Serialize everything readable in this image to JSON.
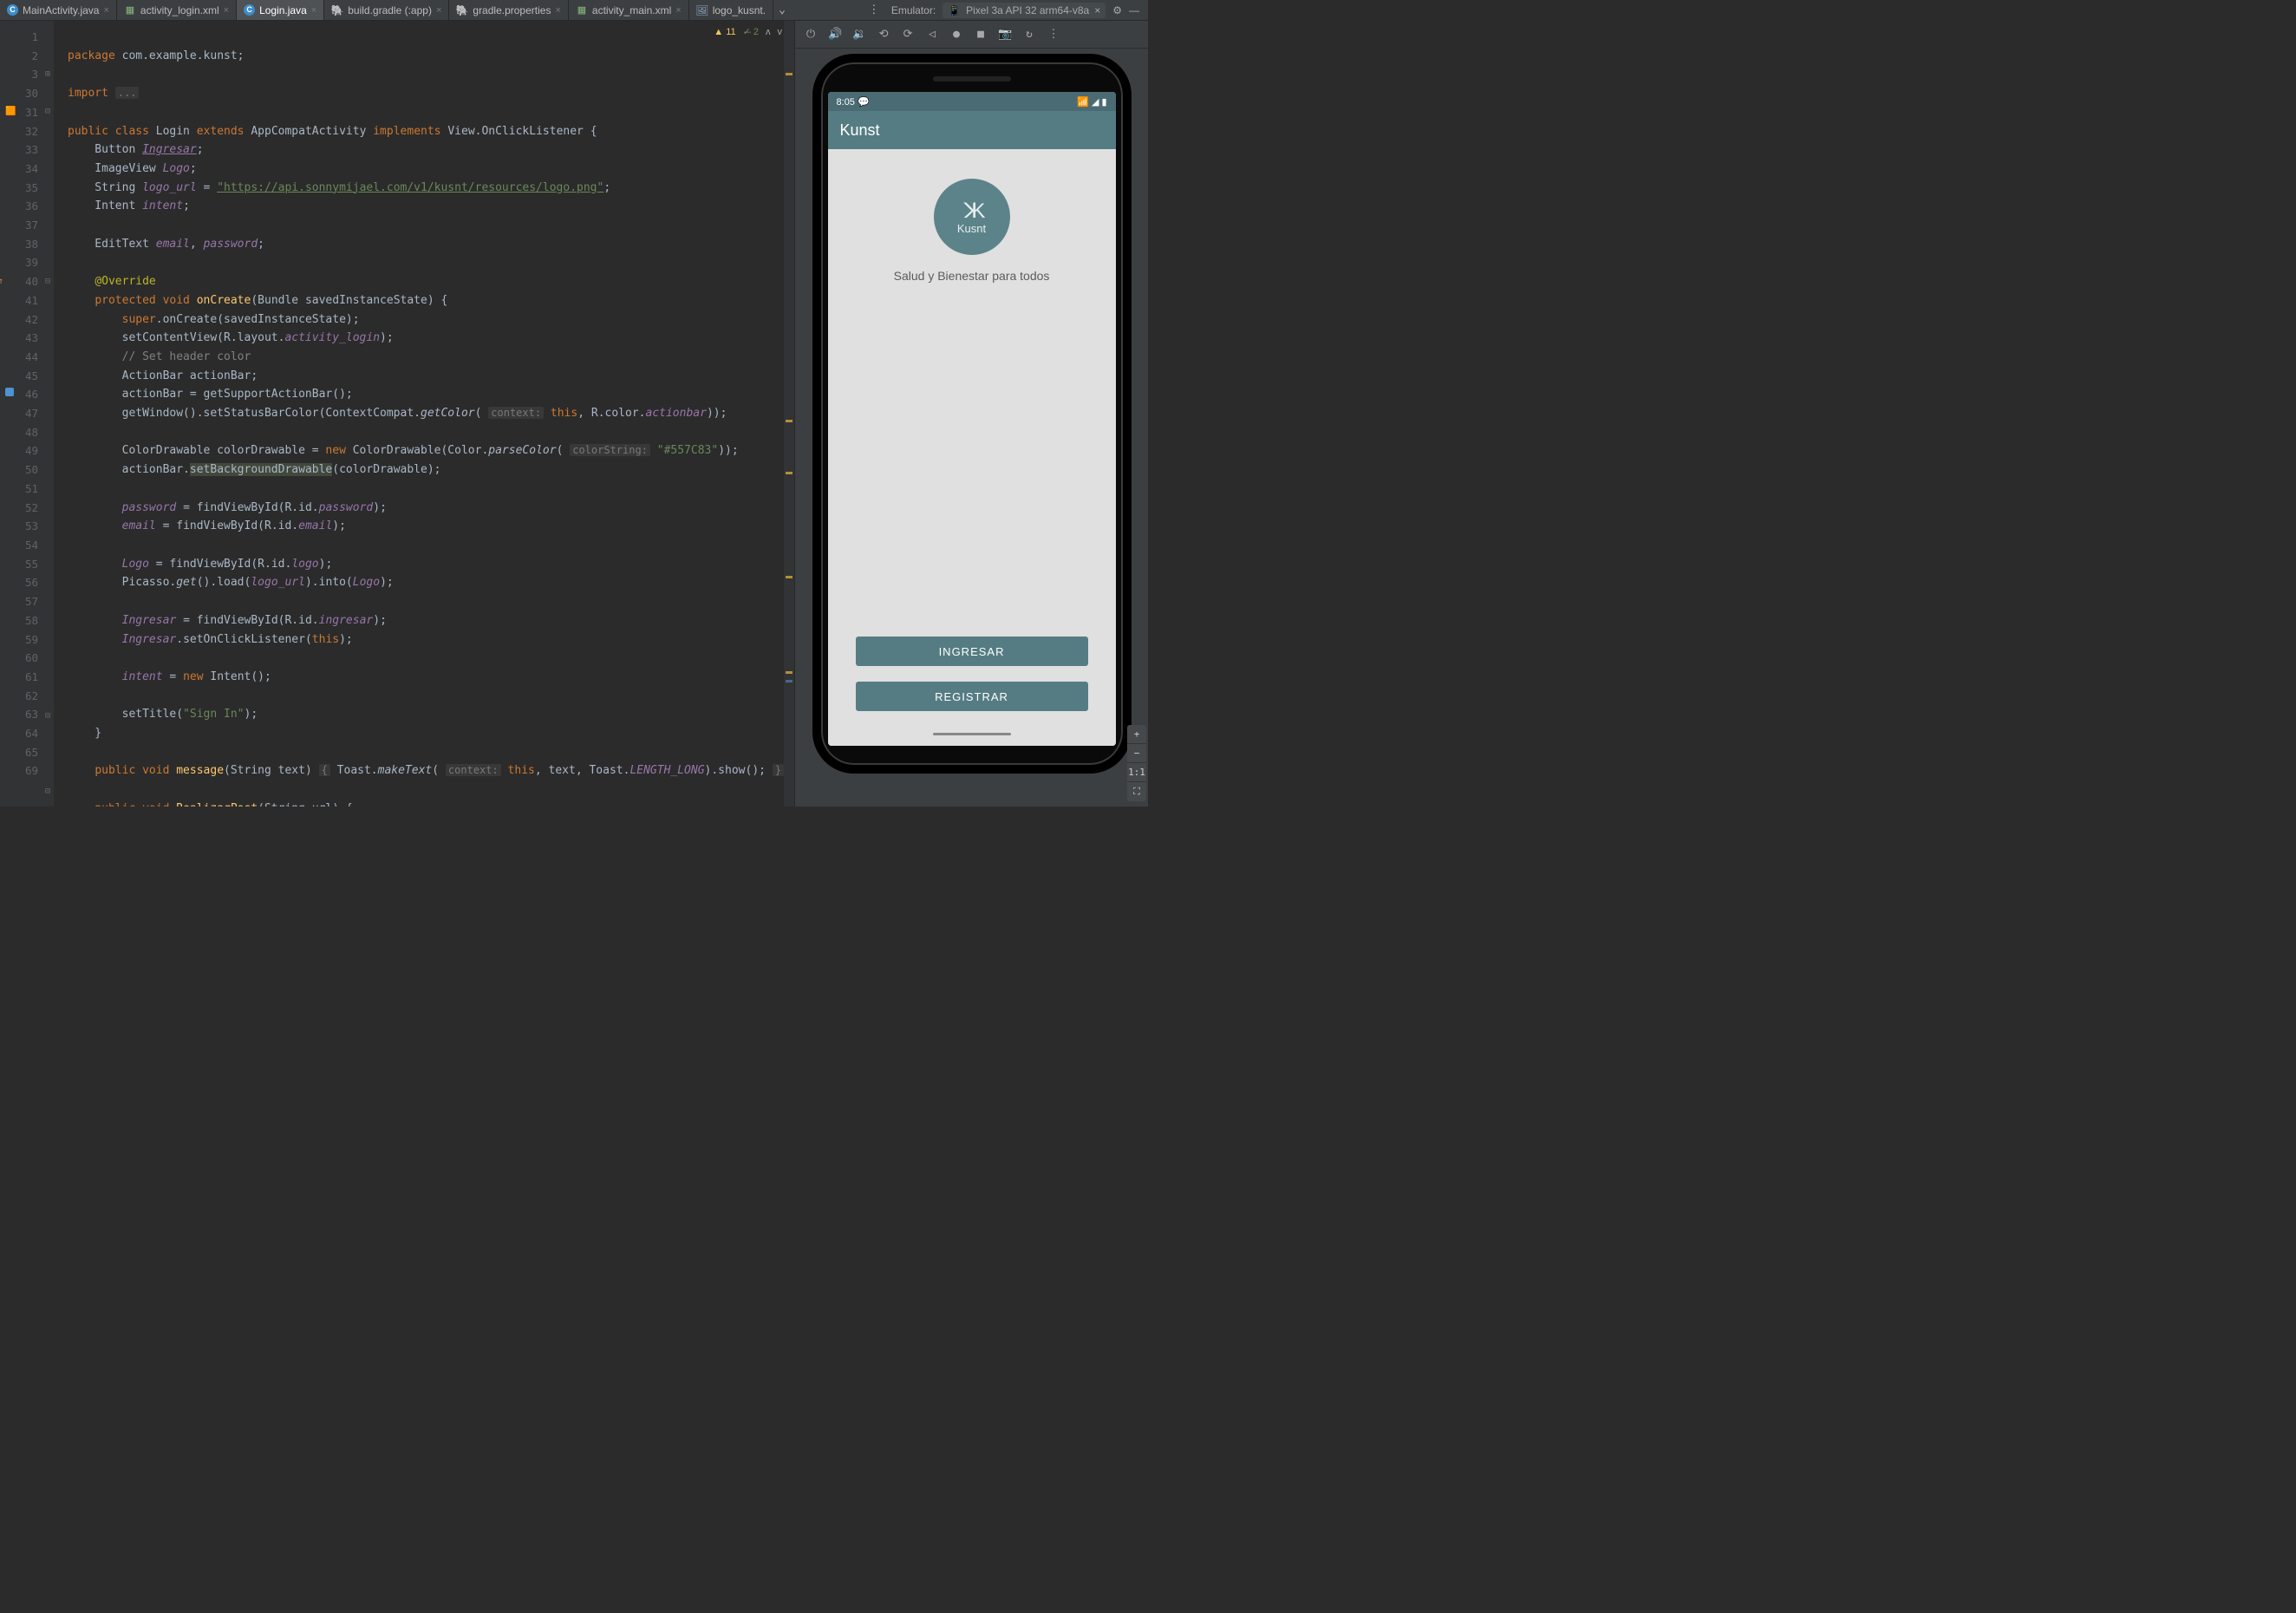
{
  "tabs": [
    {
      "label": "MainActivity.java",
      "type": "class"
    },
    {
      "label": "activity_login.xml",
      "type": "xml"
    },
    {
      "label": "Login.java",
      "type": "class",
      "active": true
    },
    {
      "label": "build.gradle (:app)",
      "type": "gradle"
    },
    {
      "label": "gradle.properties",
      "type": "props"
    },
    {
      "label": "activity_main.xml",
      "type": "xml"
    },
    {
      "label": "logo_kusnt.",
      "type": "img"
    }
  ],
  "emulator_header": {
    "label": "Emulator:",
    "device": "Pixel 3a API 32 arm64-v8a"
  },
  "editor_badges": {
    "warn_count": "11",
    "ok_count": "2"
  },
  "gutter_lines": [
    "1",
    "2",
    "3",
    "30",
    "31",
    "32",
    "33",
    "34",
    "35",
    "36",
    "37",
    "38",
    "39",
    "40",
    "41",
    "42",
    "43",
    "44",
    "45",
    "46",
    "47",
    "48",
    "49",
    "50",
    "51",
    "52",
    "53",
    "54",
    "55",
    "56",
    "57",
    "58",
    "59",
    "60",
    "61",
    "62",
    "63",
    "64",
    "65",
    "",
    "69"
  ],
  "code": {
    "l1_package": "package",
    "l1_pkg": " com.example.kunst;",
    "l3_import": "import",
    "l3_dots": "...",
    "l31_public": "public class",
    "l31_name": " Login ",
    "l31_extends": "extends",
    "l31_super": " AppCompatActivity ",
    "l31_implements": "implements",
    "l31_iface": " View.OnClickListener {",
    "l32": "    Button ",
    "l32_f": "Ingresar",
    "l33": "    ImageView ",
    "l33_f": "Logo",
    "l34": "    String ",
    "l34_f": "logo_url",
    "l34_eq": " = ",
    "l34_str": "\"https://api.sonnymijael.com/v1/kusnt/resources/logo.png\"",
    "l35": "    Intent ",
    "l35_f": "intent",
    "l37": "    EditText ",
    "l37_f1": "email",
    "l37_f2": "password",
    "l39_anno": "@Override",
    "l40_kw": "protected void",
    "l40_fn": "onCreate",
    "l40_rest": "(Bundle savedInstanceState) {",
    "l41_super": "super",
    "l41_rest": ".onCreate(savedInstanceState);",
    "l42": "        setContentView(R.layout.",
    "l42_f": "activity_login",
    "l42_end": ");",
    "l43_com": "        // Set header color",
    "l44": "        ActionBar actionBar;",
    "l45": "        actionBar = getSupportActionBar();",
    "l46a": "        getWindow().setStatusBarColor(ContextCompat.",
    "l46_get": "getColor",
    "l46_hint": "context:",
    "l46_this": "this",
    "l46b": ", R.color.",
    "l46_f": "actionbar",
    "l46_end": "));",
    "l48a": "        ColorDrawable colorDrawable = ",
    "l48_new": "new",
    "l48b": " ColorDrawable(Color.",
    "l48_parse": "parseColor",
    "l48_hint": "colorString:",
    "l48_str": "\"#557C83\"",
    "l48_end": "));",
    "l49a": "        actionBar.",
    "l49_hl": "setBackgroundDrawable",
    "l49b": "(colorDrawable);",
    "l51a": "        ",
    "l51_f": "password",
    "l51b": " = findViewById(R.id.",
    "l51_f2": "password",
    "l51_end": ");",
    "l52_f": "email",
    "l52b": " = findViewById(R.id.",
    "l52_f2": "email",
    "l54_f": "Logo",
    "l54b": " = findViewById(R.id.",
    "l54_f2": "logo",
    "l55a": "        Picasso.",
    "l55_get": "get",
    "l55b": "().load(",
    "l55_f": "logo_url",
    "l55c": ").into(",
    "l55_f2": "Logo",
    "l57_f": "Ingresar",
    "l57b": " = findViewById(R.id.",
    "l57_f2": "ingresar",
    "l58_f": "Ingresar",
    "l58b": ".setOnClickListener(",
    "l58_this": "this",
    "l60_f": "intent",
    "l60b": " = ",
    "l60_new": "new",
    "l60c": " Intent();",
    "l62a": "        setTitle(",
    "l62_str": "\"Sign In\"",
    "l62b": ");",
    "l63": "    }",
    "l65_kw": "public void",
    "l65_fn": "message",
    "l65a": "(String text) ",
    "l65_br": "{",
    "l65b": " Toast.",
    "l65_make": "makeText",
    "l65_hint": "context:",
    "l65_this": "this",
    "l65c": ", text, Toast.",
    "l65_const": "LENGTH_LONG",
    "l65d": ").show(); ",
    "l65_br2": "}",
    "l69_kw": "public void",
    "l69_fn": "RealizarPost",
    "l69_rest": "(String url) {"
  },
  "phone": {
    "time": "8:05",
    "app_title": "Kunst",
    "logo_top": "KK",
    "logo_bottom": "Kusnt",
    "tagline": "Salud y Bienestar para todos",
    "btn_ingresar": "INGRESAR",
    "btn_registrar": "REGISTRAR"
  },
  "zoom": {
    "plus": "+",
    "minus": "−",
    "ratio": "1:1",
    "fit": "⛶"
  }
}
